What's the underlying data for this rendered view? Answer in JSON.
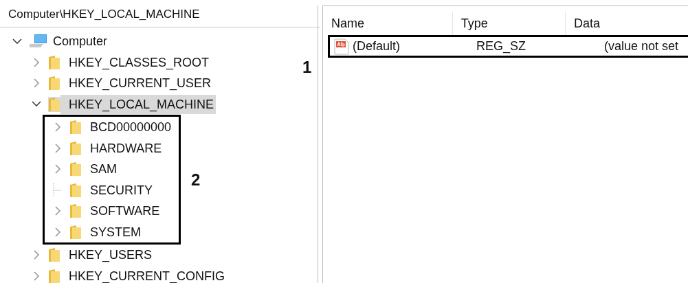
{
  "address_bar": {
    "path": "Computer\\HKEY_LOCAL_MACHINE"
  },
  "tree": [
    {
      "label": "Computer",
      "expanded": true,
      "selected": false,
      "children": [
        {
          "label": "HKEY_CLASSES_ROOT",
          "expanded": false,
          "selected": false
        },
        {
          "label": "HKEY_CURRENT_USER",
          "expanded": false,
          "selected": false
        },
        {
          "label": "HKEY_LOCAL_MACHINE",
          "expanded": true,
          "selected": true,
          "children_callout": "2",
          "children": [
            {
              "label": "BCD00000000",
              "expanded": false,
              "selected": false
            },
            {
              "label": "HARDWARE",
              "expanded": false,
              "selected": false
            },
            {
              "label": "SAM",
              "expanded": false,
              "selected": false
            },
            {
              "label": "SECURITY",
              "selected": false
            },
            {
              "label": "SOFTWARE",
              "expanded": false,
              "selected": false
            },
            {
              "label": "SYSTEM",
              "expanded": false,
              "selected": false
            }
          ]
        },
        {
          "label": "HKEY_USERS",
          "expanded": false,
          "selected": false
        },
        {
          "label": "HKEY_CURRENT_CONFIG",
          "expanded": false,
          "selected": false
        }
      ]
    }
  ],
  "values_table": {
    "columns": [
      "Name",
      "Type",
      "Data"
    ],
    "rows": [
      {
        "name": "(Default)",
        "type": "REG_SZ",
        "data": "(value not set",
        "callout": "1"
      }
    ]
  }
}
